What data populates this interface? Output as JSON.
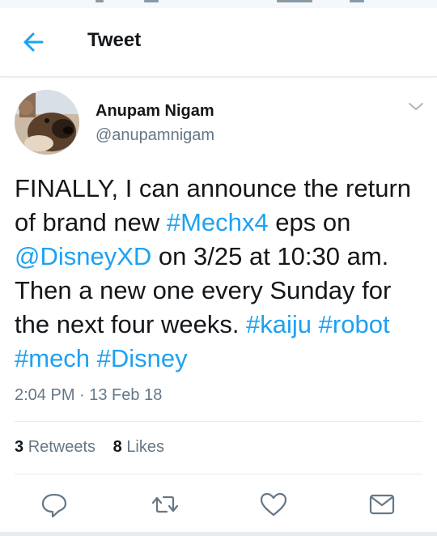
{
  "header": {
    "title": "Tweet",
    "back_icon": "arrow-left-icon",
    "accent": "#1da1f2"
  },
  "tweet": {
    "author": {
      "name": "Anupam Nigam",
      "handle": "@anupamnigam"
    },
    "text_segments": [
      {
        "text": "FINALLY, I can announce the return of brand new ",
        "link": false
      },
      {
        "text": "#Mechx4",
        "link": true
      },
      {
        "text": " eps on ",
        "link": false
      },
      {
        "text": "@DisneyXD",
        "link": true
      },
      {
        "text": " on 3/25 at 10:30 am. Then a new one every Sunday for the next four weeks. ",
        "link": false
      },
      {
        "text": "#kaiju",
        "link": true
      },
      {
        "text": " ",
        "link": false
      },
      {
        "text": "#robot",
        "link": true
      },
      {
        "text": " ",
        "link": false
      },
      {
        "text": "#mech",
        "link": true
      },
      {
        "text": " ",
        "link": false
      },
      {
        "text": "#Disney",
        "link": true
      }
    ],
    "timestamp": "2:04 PM · 13 Feb 18",
    "stats": {
      "retweets_count": "3",
      "retweets_label": "Retweets",
      "likes_count": "8",
      "likes_label": "Likes"
    },
    "actions": [
      "reply-icon",
      "retweet-icon",
      "like-icon",
      "share-icon"
    ]
  },
  "colors": {
    "link": "#1da1f2",
    "secondary_text": "#657786",
    "divider": "#e6ecf0"
  }
}
